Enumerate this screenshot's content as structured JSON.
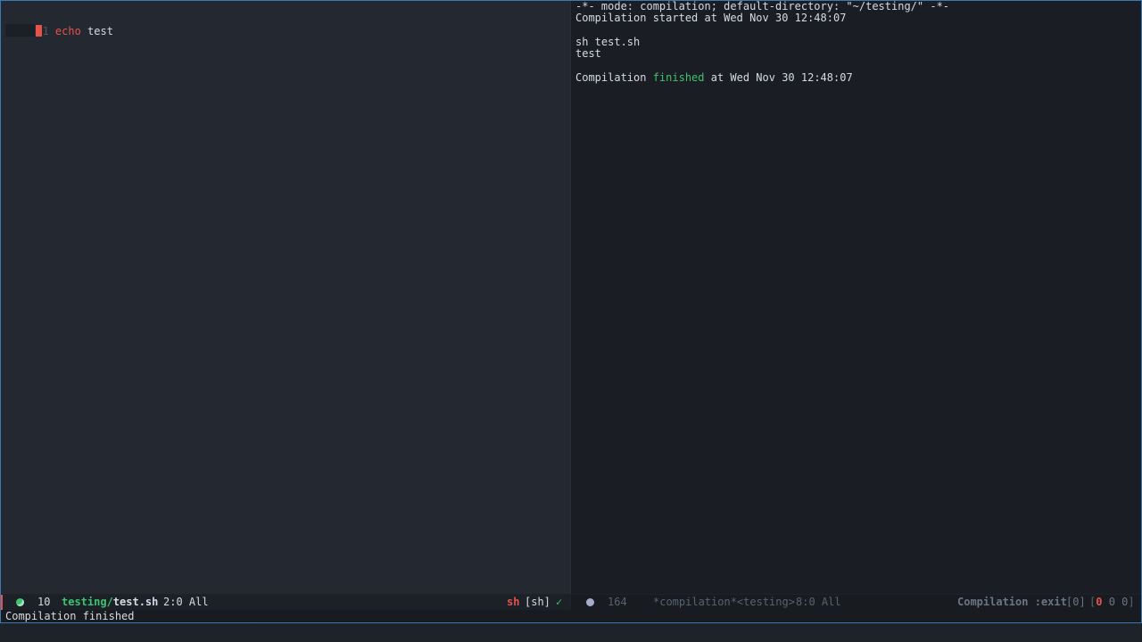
{
  "editor": {
    "line_number": "1",
    "keyword": "echo",
    "argument": " test"
  },
  "compilation": {
    "header": "-*- mode: compilation; default-directory: \"~/testing/\" -*-",
    "started": "Compilation started at Wed Nov 30 12:48:07",
    "command": "sh test.sh",
    "output": "test",
    "finished_prefix": "Compilation ",
    "finished_word": "finished",
    "finished_suffix": " at Wed Nov 30 12:48:07"
  },
  "modeline_left": {
    "count": "10",
    "dir": "testing/",
    "file": "test.sh",
    "position": "2:0 All",
    "mode": "sh",
    "mode_bracket": "[sh]",
    "check": "✓"
  },
  "modeline_right": {
    "count": "164",
    "buffer": "*compilation*<testing>",
    "position": "8:0 All",
    "status_label": "Compilation :exit",
    "exit_code": "[0]",
    "counts_open": "[",
    "count_err": "0",
    "count_warn": "0",
    "count_info": "0",
    "counts_close": "]"
  },
  "minibuffer": {
    "message": "Compilation finished"
  },
  "colors": {
    "accent_red": "#e5534b",
    "success_green": "#3ec46f",
    "frame_border": "#3a78b8"
  }
}
